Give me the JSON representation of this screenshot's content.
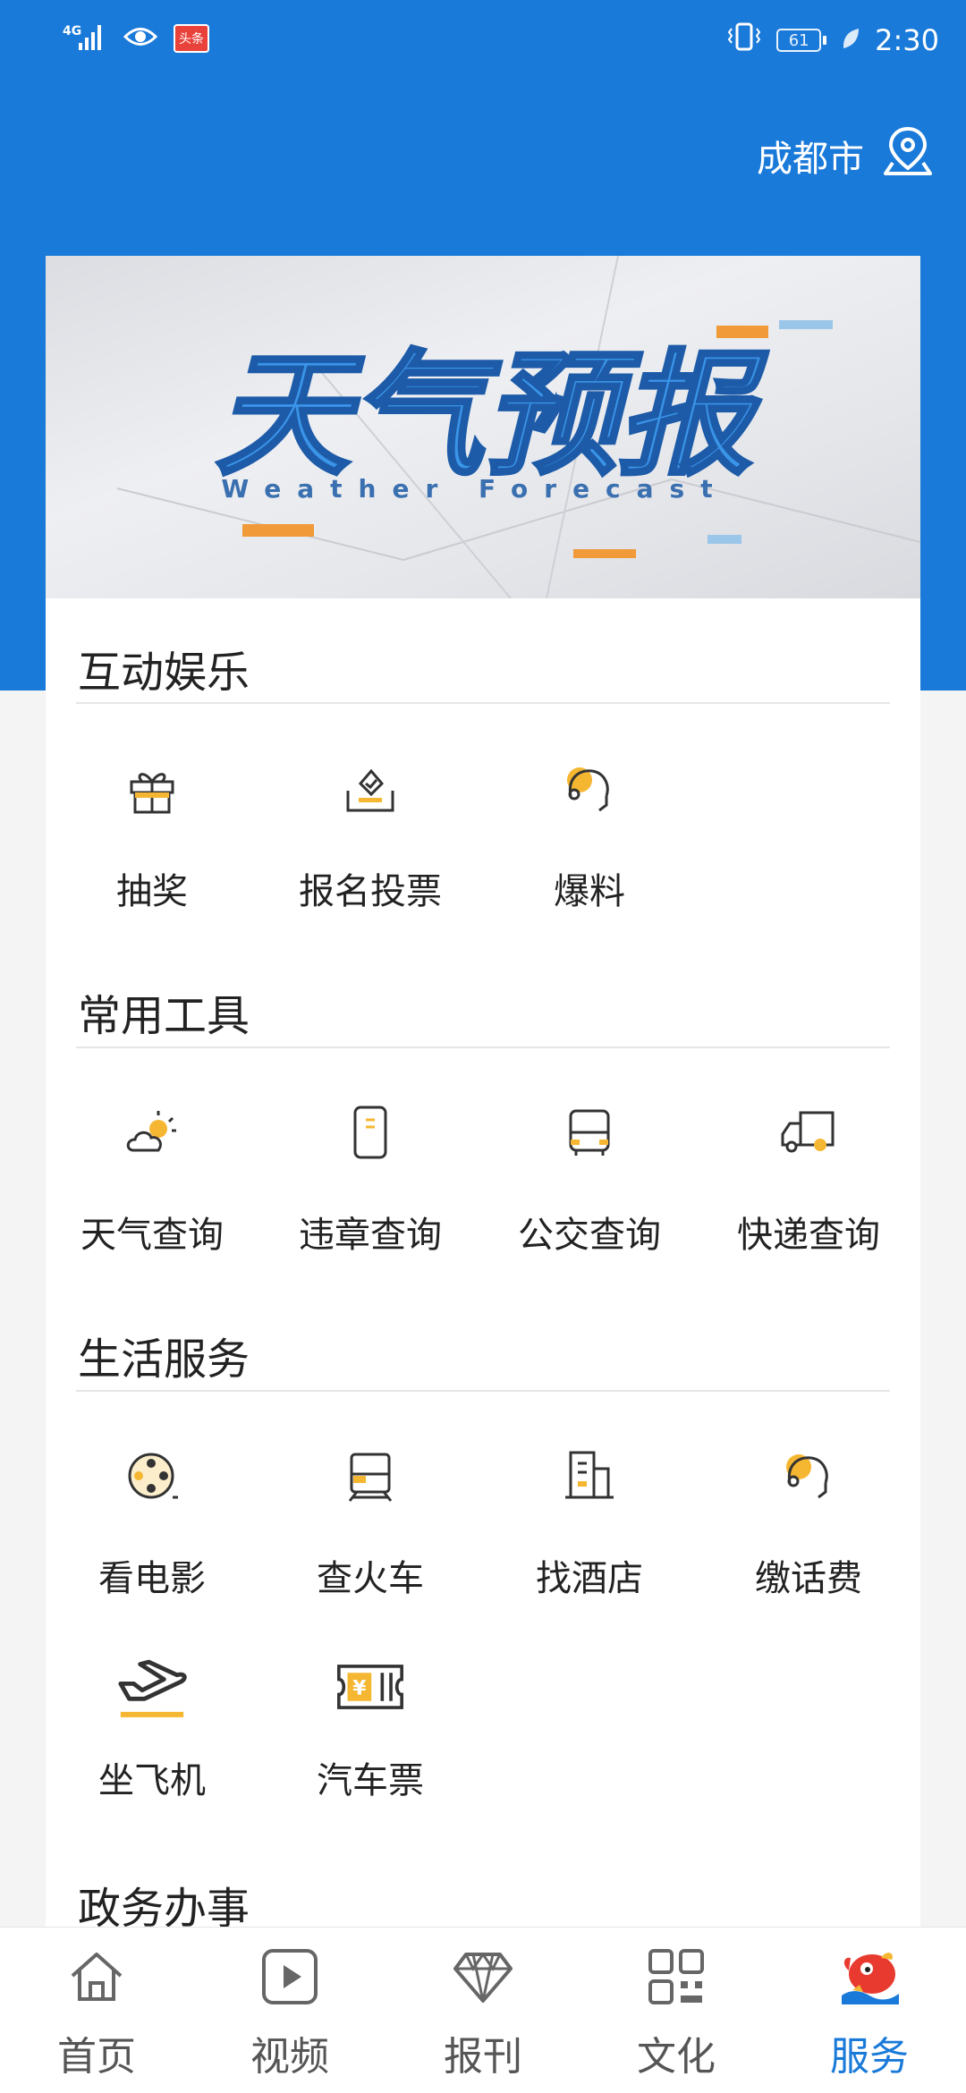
{
  "status_bar": {
    "network": "4G",
    "badge": "头条",
    "battery": "61",
    "time": "2:30"
  },
  "header": {
    "city": "成都市"
  },
  "banner": {
    "title_cn": "天气预报",
    "title_en": "Weather Forecast"
  },
  "sections": {
    "entertainment": {
      "title": "互动娱乐",
      "items": [
        {
          "label": "抽奖",
          "icon": "gift-icon"
        },
        {
          "label": "报名投票",
          "icon": "vote-icon"
        },
        {
          "label": "爆料",
          "icon": "headset-icon"
        }
      ]
    },
    "tools": {
      "title": "常用工具",
      "items": [
        {
          "label": "天气查询",
          "icon": "weather-icon"
        },
        {
          "label": "违章查询",
          "icon": "violation-icon"
        },
        {
          "label": "公交查询",
          "icon": "bus-icon"
        },
        {
          "label": "快递查询",
          "icon": "truck-icon"
        }
      ]
    },
    "life": {
      "title": "生活服务",
      "items": [
        {
          "label": "看电影",
          "icon": "film-reel-icon"
        },
        {
          "label": "查火车",
          "icon": "train-icon"
        },
        {
          "label": "找酒店",
          "icon": "hotel-icon"
        },
        {
          "label": "缴话费",
          "icon": "headset-icon"
        },
        {
          "label": "坐飞机",
          "icon": "airplane-icon"
        },
        {
          "label": "汽车票",
          "icon": "ticket-icon"
        }
      ]
    },
    "government": {
      "title": "政务办事"
    }
  },
  "bottom_nav": [
    {
      "label": "首页",
      "icon": "home-icon"
    },
    {
      "label": "视频",
      "icon": "play-icon"
    },
    {
      "label": "报刊",
      "icon": "diamond-icon"
    },
    {
      "label": "文化",
      "icon": "grid-icon"
    },
    {
      "label": "服务",
      "icon": "mascot-icon",
      "active": true
    }
  ],
  "colors": {
    "primary": "#1a7ad9",
    "accent": "#f5b731",
    "icon_stroke": "#333333"
  }
}
